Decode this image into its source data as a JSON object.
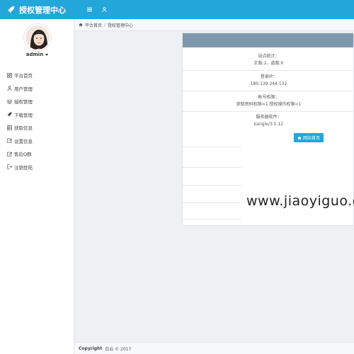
{
  "header": {
    "title": "授权管理中心",
    "icons": [
      "rocket-icon",
      "menu-icon",
      "user-icon"
    ],
    "color": "#23a6d9"
  },
  "sidebar": {
    "user": {
      "name": "admin"
    },
    "items": [
      {
        "label": "平台首页",
        "icon": "grid-icon"
      },
      {
        "label": "用户管理",
        "icon": "user-icon"
      },
      {
        "label": "授权管理",
        "icon": "layers-icon"
      },
      {
        "label": "下载管理",
        "icon": "rocket-icon"
      },
      {
        "label": "获取信息",
        "icon": "table-icon"
      },
      {
        "label": "设置信息",
        "icon": "edit-icon"
      },
      {
        "label": "售后Q群",
        "icon": "edit-icon"
      },
      {
        "label": "注销登陆",
        "icon": "logout-icon"
      }
    ]
  },
  "breadcrumb": {
    "items": [
      "平台首页",
      "授权管理中心"
    ]
  },
  "panel": {
    "header_color": "#7f98ae",
    "site_stats": {
      "label": "站点统计：",
      "value": "正版:2，盗版:0"
    },
    "login_ip": {
      "label": "登录IP：",
      "value": "180.139.244.132"
    },
    "permissions": {
      "label": "账号权限：",
      "value": "获取密码权限=1 授权操作权限=1"
    },
    "server": {
      "label": "服务器软件：",
      "value": "kangle/3.5.12"
    },
    "home_button": "网站首页"
  },
  "watermark": "www.jiaoyiguo.c",
  "footer": {
    "copyright": "Copyright",
    "text": "白云 © 2017"
  }
}
